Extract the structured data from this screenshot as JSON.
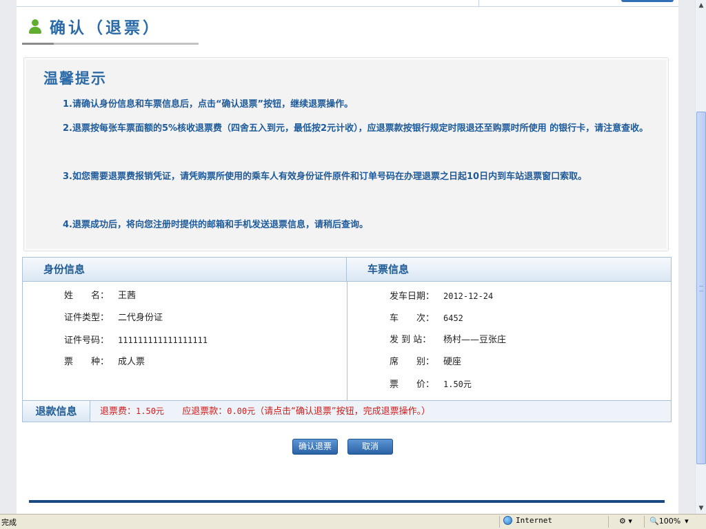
{
  "page": {
    "title": "确认（退票）"
  },
  "tips": {
    "title": "温馨提示",
    "items": [
      "1.请确认身份信息和车票信息后，点击“确认退票”按钮，继续退票操作。",
      "2.退票按每张车票面额的5%核收退票费（四舍五入到元，最低按2元计收），应退票款按银行规定时限退还至购票时所使用 的银行卡，请注意查收。",
      "3.如您需要退票费报销凭证，请凭购票所使用的乘车人有效身份证件原件和订单号码在办理退票之日起10日内到车站退票窗口索取。",
      "4.退票成功后，将向您注册时提供的邮箱和手机发送退票信息，请稍后查询。"
    ]
  },
  "identity": {
    "header": "身份信息",
    "rows": [
      {
        "label": "姓　　名：",
        "value": "王茜"
      },
      {
        "label": "证件类型：",
        "value": "二代身份证"
      },
      {
        "label": "证件号码：",
        "value": "111111111111111111"
      },
      {
        "label": "票　　种：",
        "value": "成人票"
      }
    ]
  },
  "ticket": {
    "header": "车票信息",
    "rows": [
      {
        "label": "发车日期：",
        "value": "2012-12-24"
      },
      {
        "label": "车　　次：",
        "value": "6452"
      },
      {
        "label": "发 到 站：",
        "value": "杨村——豆张庄"
      },
      {
        "label": "席　　别：",
        "value": "硬座"
      },
      {
        "label": "票　　价：",
        "value": "1.50元"
      }
    ]
  },
  "refund": {
    "label": "退款信息",
    "fee_label": "退票费：",
    "fee_value": "1.50元",
    "amount_label": "应退票款：",
    "amount_value": "0.00元",
    "note": "（请点击“确认退票”按钮，完成退票操作。）"
  },
  "buttons": {
    "confirm": "确认退票",
    "cancel": "取消"
  },
  "statusbar": {
    "status": "完成",
    "zone": "Internet",
    "zoom": "100%"
  },
  "colors": {
    "accent": "#2b6aa8",
    "refund_text": "#d11b1b",
    "footer_bar": "#17497e"
  }
}
